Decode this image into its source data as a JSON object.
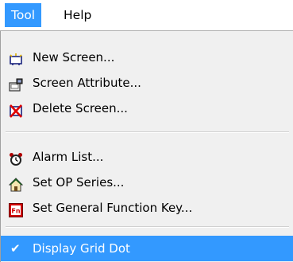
{
  "menubar": {
    "items": [
      {
        "label": "Tool"
      },
      {
        "label": "Help"
      }
    ]
  },
  "menu": {
    "items": [
      {
        "label": "New Screen...",
        "icon": "new-screen-icon"
      },
      {
        "label": "Screen Attribute...",
        "icon": "screen-attribute-icon"
      },
      {
        "label": "Delete Screen...",
        "icon": "delete-screen-icon"
      },
      {
        "label": "Alarm List...",
        "icon": "alarm-clock-icon"
      },
      {
        "label": "Set OP Series...",
        "icon": "house-icon"
      },
      {
        "label": "Set General Function Key...",
        "icon": "function-key-icon"
      },
      {
        "label": "Display Grid Dot",
        "icon": "checkmark-icon",
        "checked": true
      }
    ]
  },
  "colors": {
    "highlight": "#3399ff",
    "menu_background": "#f0f0f0",
    "menubar_background": "#ffffff"
  }
}
